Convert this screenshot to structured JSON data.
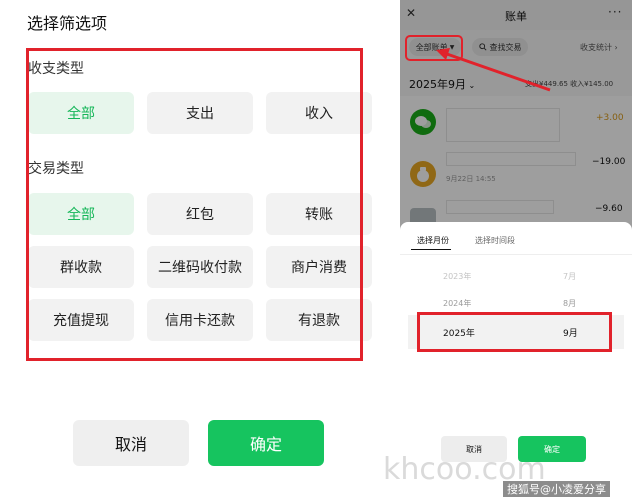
{
  "filter_panel": {
    "title": "选择筛选项",
    "income_section": {
      "label": "收支类型",
      "options": [
        "全部",
        "支出",
        "收入"
      ],
      "selected": "全部"
    },
    "tx_section": {
      "label": "交易类型",
      "options": [
        "全部",
        "红包",
        "转账",
        "群收款",
        "二维码收付款",
        "商户消费",
        "充值提现",
        "信用卡还款",
        "有退款"
      ],
      "selected": "全部"
    },
    "cancel_label": "取消",
    "confirm_label": "确定"
  },
  "bill_screen": {
    "title": "账单",
    "close_glyph": "✕",
    "more_glyph": "···",
    "all_bills_label": "全部账单",
    "search_label": "查找交易",
    "stats_label": "收支统计",
    "month_label": "2025年9月",
    "summary": "支出¥449.65  收入¥145.00",
    "rows": [
      {
        "amount": "+3.00",
        "amount_color": "#d89a1c"
      },
      {
        "subtitle": "9月22日 14:55",
        "amount": "−19.00",
        "amount_color": "#111111"
      },
      {
        "amount": "−9.60",
        "amount_color": "#111111"
      }
    ]
  },
  "month_sheet": {
    "tab_month": "选择月份",
    "tab_range": "选择时间段",
    "picker_rows": [
      {
        "year": "2023年",
        "month": "7月"
      },
      {
        "year": "2024年",
        "month": "8月"
      }
    ],
    "selected": {
      "year": "2025年",
      "month": "9月"
    },
    "cancel_label": "取消",
    "confirm_label": "确定"
  },
  "watermark": {
    "site": "khcoo.com",
    "credit": "搜狐号@小凌爱分享"
  },
  "colors": {
    "accent_green": "#16c45f",
    "highlight_red": "#e1222b"
  }
}
